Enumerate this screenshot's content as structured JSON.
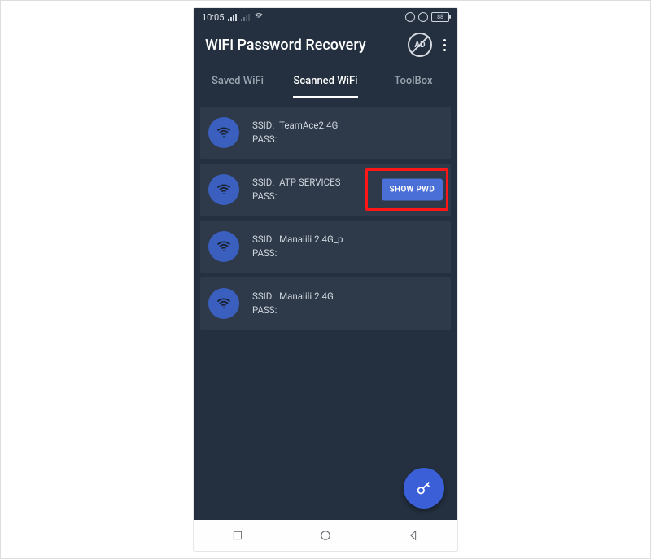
{
  "status": {
    "time": "10:05",
    "battery": "88"
  },
  "app": {
    "title": "WiFi Password Recovery"
  },
  "tabs": [
    {
      "label": "Saved WiFi",
      "active": false
    },
    {
      "label": "Scanned WiFi",
      "active": true
    },
    {
      "label": "ToolBox",
      "active": false
    }
  ],
  "labels": {
    "ssid": "SSID:",
    "pass": "PASS:",
    "show_pwd": "SHOW PWD"
  },
  "networks": [
    {
      "ssid": "TeamAce2.4G",
      "pass": "",
      "show_button": false,
      "highlight": false
    },
    {
      "ssid": "ATP SERVICES",
      "pass": "",
      "show_button": true,
      "highlight": true
    },
    {
      "ssid": "Manalili 2.4G_p",
      "pass": "",
      "show_button": false,
      "highlight": false
    },
    {
      "ssid": "Manalili 2.4G",
      "pass": "",
      "show_button": false,
      "highlight": false
    }
  ]
}
